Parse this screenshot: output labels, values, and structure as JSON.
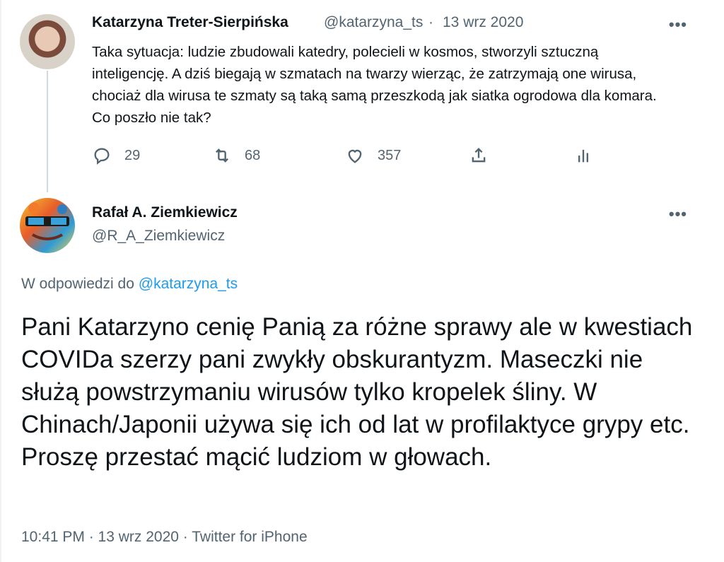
{
  "tweet1": {
    "name": "Katarzyna Treter-Sierpińska",
    "handle": "@katarzyna_ts",
    "separator": "·",
    "date": "13 wrz 2020",
    "more": "•••",
    "text": "Taka sytuacja: ludzie zbudowali katedry, polecieli w kosmos, stworzyli sztuczną inteligencję. A dziś biegają w szmatach na twarzy wierząc, że zatrzymają one wirusa, chociaż dla wirusa te szmaty są taką samą przeszkodą jak siatka ogrodowa dla komara. Co poszło nie tak?",
    "actions": {
      "replies": "29",
      "retweets": "68",
      "likes": "357"
    }
  },
  "tweet2": {
    "name": "Rafał A. Ziemkiewicz",
    "handle": "@R_A_Ziemkiewicz",
    "more": "•••",
    "reply_prefix": "W odpowiedzi do",
    "reply_handle": "@katarzyna_ts",
    "text": "Pani Katarzyno cenię Panią za różne sprawy ale w kwestiach COVIDa szerzy pani zwykły obskurantyzm. Maseczki nie służą powstrzymaniu wirusów tylko kropelek śliny. W Chinach/Japonii używa się ich od lat w profilaktyce grypy etc. Proszę przestać mącić ludziom w głowach.",
    "meta": "10:41 PM · 13 wrz 2020 · Twitter for iPhone"
  },
  "icons": {
    "reply": "reply-icon",
    "retweet": "retweet-icon",
    "like": "heart-icon",
    "share": "share-icon",
    "analytics": "analytics-icon",
    "more": "more-icon"
  },
  "colors": {
    "link": "#1d9bf0",
    "secondary_text": "#536471",
    "primary_text": "#0f1419"
  }
}
